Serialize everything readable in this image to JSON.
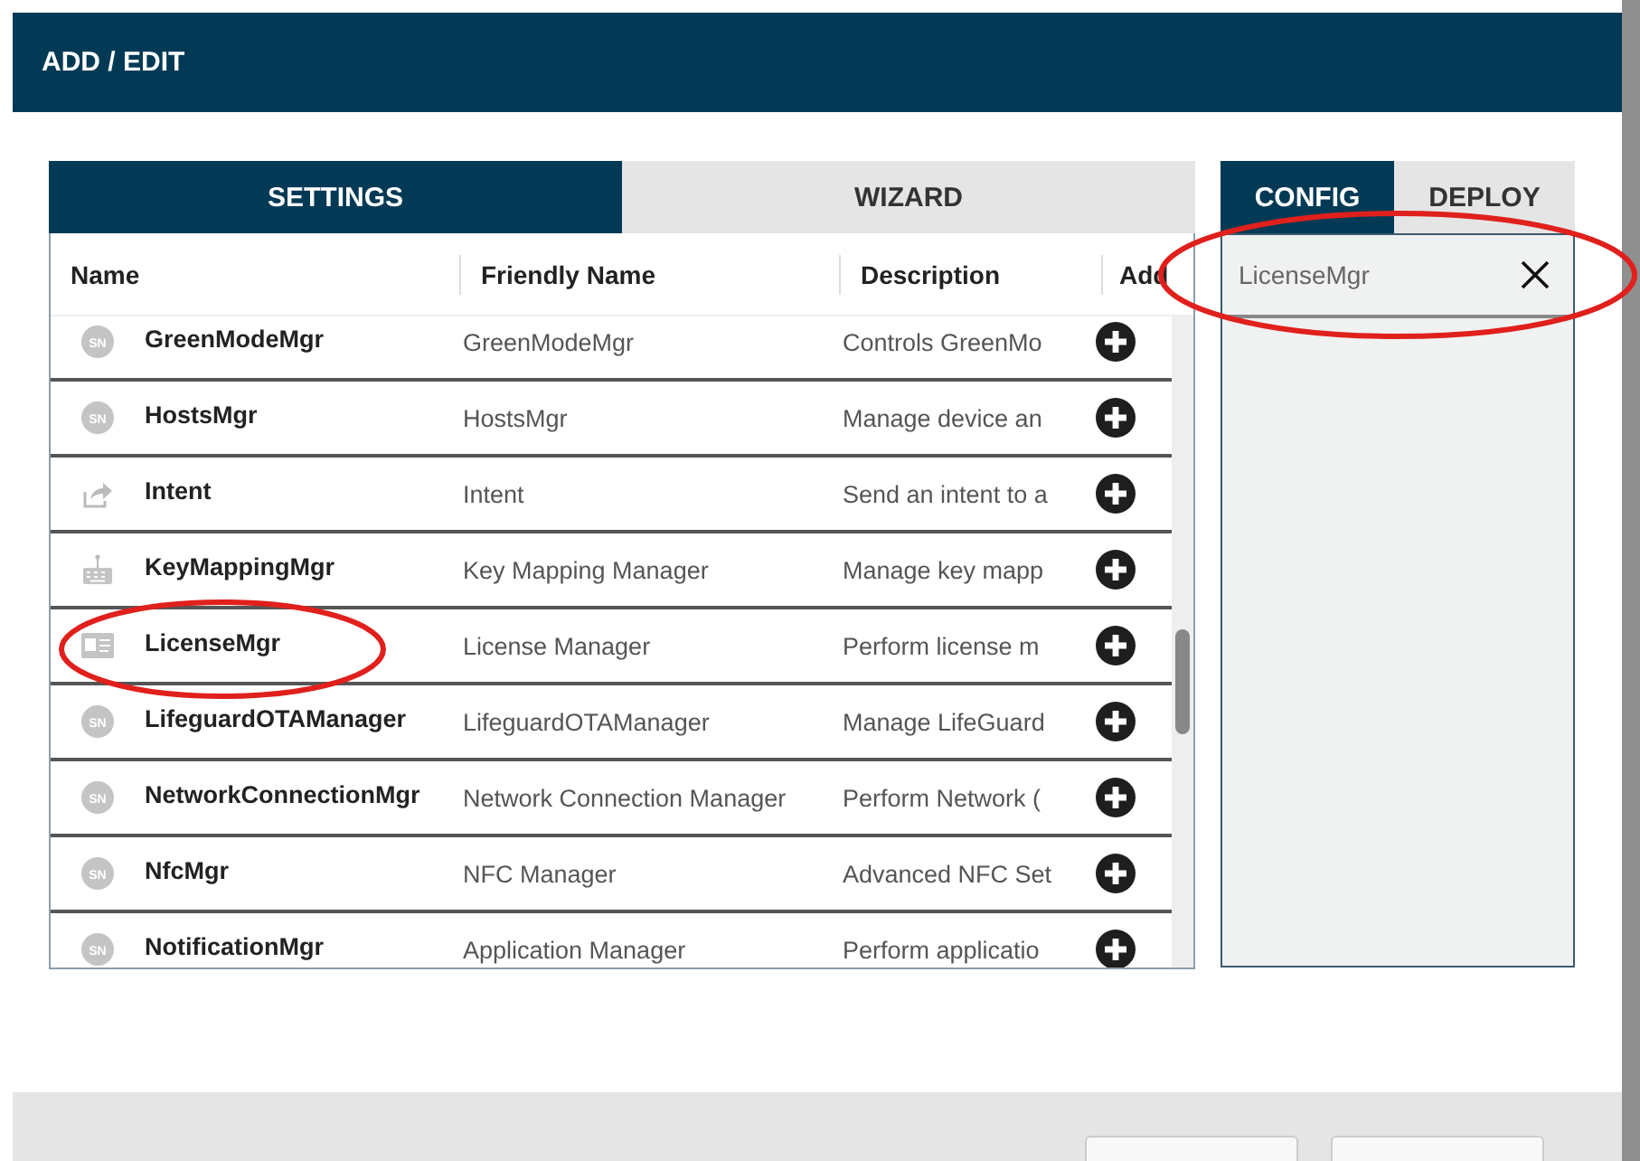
{
  "dialog": {
    "title": "ADD / EDIT"
  },
  "tabs": [
    {
      "label": "SETTINGS",
      "selected": true
    },
    {
      "label": "WIZARD",
      "selected": false
    }
  ],
  "table": {
    "columns": [
      "Name",
      "Friendly Name",
      "Description",
      "Add"
    ],
    "rows": [
      {
        "kind": "sn",
        "badge": "SN",
        "name": "GreenModeMgr",
        "friendly_name": "GreenModeMgr",
        "description": "Controls GreenMo",
        "circled": false
      },
      {
        "kind": "sn",
        "badge": "SN",
        "name": "HostsMgr",
        "friendly_name": "HostsMgr",
        "description": "Manage device an",
        "circled": false
      },
      {
        "kind": "share",
        "name": "Intent",
        "friendly_name": "Intent",
        "description": "Send an intent to a",
        "circled": false
      },
      {
        "kind": "keyboard",
        "name": "KeyMappingMgr",
        "friendly_name": "Key Mapping Manager",
        "description": "Manage key mapp",
        "circled": false
      },
      {
        "kind": "card",
        "name": "LicenseMgr",
        "friendly_name": "License Manager",
        "description": "Perform license m",
        "circled": true
      },
      {
        "kind": "sn",
        "badge": "SN",
        "name": "LifeguardOTAManager",
        "friendly_name": "LifeguardOTAManager",
        "description": "Manage LifeGuard",
        "circled": false
      },
      {
        "kind": "sn",
        "badge": "SN",
        "name": "NetworkConnectionMgr",
        "friendly_name": "Network Connection Manager",
        "description": "Perform Network (",
        "circled": false
      },
      {
        "kind": "sn",
        "badge": "SN",
        "name": "NfcMgr",
        "friendly_name": "NFC Manager",
        "description": "Advanced NFC Set",
        "circled": false
      },
      {
        "kind": "sn",
        "badge": "SN",
        "name": "NotificationMgr",
        "friendly_name": "Application Manager",
        "description": "Perform applicatio",
        "circled": false
      }
    ]
  },
  "side_tabs": [
    {
      "label": "CONFIG",
      "selected": true
    },
    {
      "label": "DEPLOY",
      "selected": false
    }
  ],
  "config_items": [
    {
      "label": "LicenseMgr",
      "circled": true
    }
  ]
}
